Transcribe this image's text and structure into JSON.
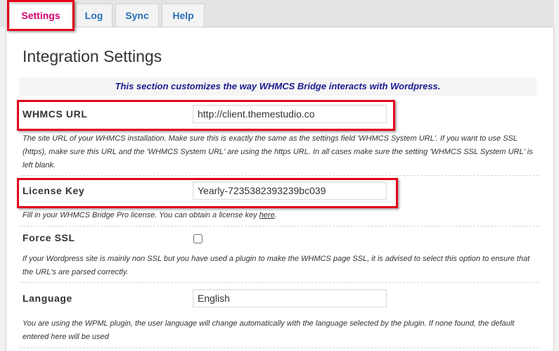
{
  "tabs": [
    {
      "label": "Settings",
      "active": true
    },
    {
      "label": "Log",
      "active": false
    },
    {
      "label": "Sync",
      "active": false
    },
    {
      "label": "Help",
      "active": false
    }
  ],
  "page_title": "Integration Settings",
  "section_intro": "This section customizes the way WHMCS Bridge interacts with Wordpress.",
  "fields": {
    "whmcs_url": {
      "label": "WHMCS URL",
      "value": "http://client.themestudio.co",
      "description_lines": [
        "The site URL of your WHMCS installation. Make sure this is exactly the same as the settings field 'WHMCS System URL'. If you want to use SSL",
        "(https), make sure this URL and the 'WHMCS System URL' are using the https URL. In all cases make sure the setting 'WHMCS SSL System URL' is",
        "left blank."
      ]
    },
    "license_key": {
      "label": "License Key",
      "value": "Yearly-7235382393239bc039",
      "description_before_link": "Fill in your WHMCS Bridge Pro license. You can obtain a license key ",
      "description_link": "here",
      "description_after_link": "."
    },
    "force_ssl": {
      "label": "Force SSL",
      "checked": false,
      "description_lines": [
        "If your Wordpress site is mainly non SSL but you have used a plugin to make the WHMCS page SSL, it is advised to select this option to ensure that",
        "the URL's are parsed correctly."
      ]
    },
    "language": {
      "label": "Language",
      "value": "English",
      "description_lines": [
        "You are using the WPML plugin, the user language will change automatically with the language selected by the plugin. If none found, the default",
        "entered here will be used"
      ]
    }
  },
  "colors": {
    "active_tab_text": "#d1006b",
    "tab_text": "#2870b8",
    "intro_text": "#1b1b8f",
    "highlight": "#e3001b"
  }
}
